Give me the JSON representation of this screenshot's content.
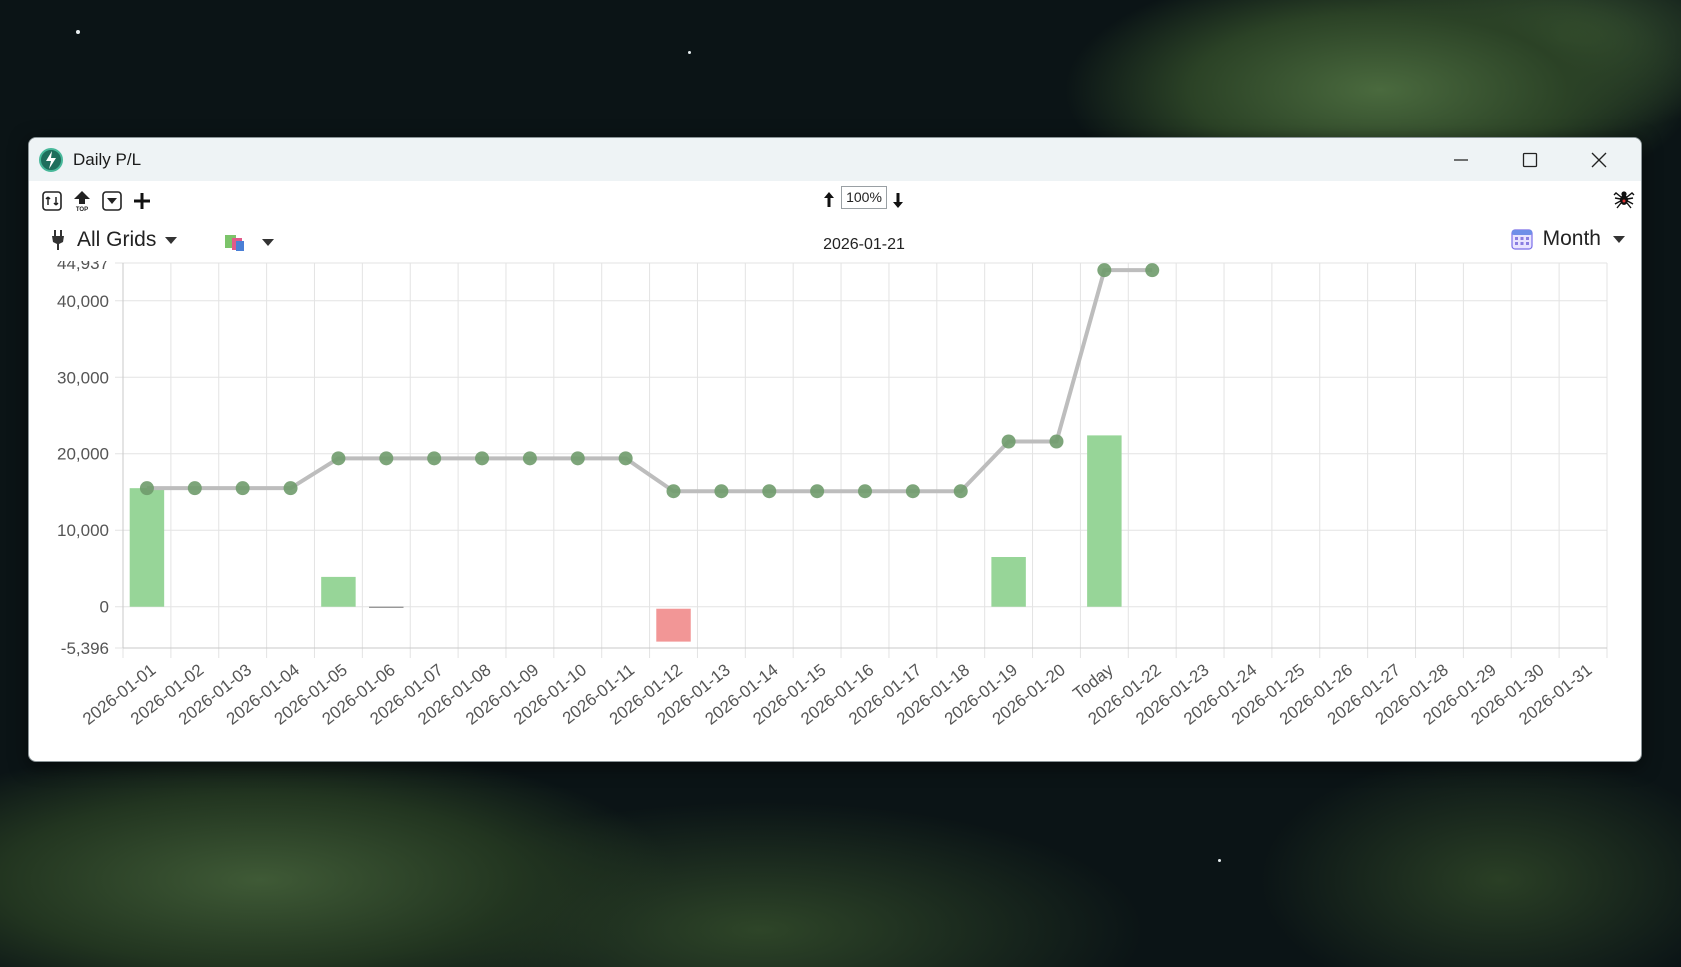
{
  "window": {
    "title": "Daily P/L"
  },
  "toolbar": {
    "zoom_value": "100%",
    "icons": [
      "refresh-icon",
      "top-icon",
      "dropdown-box-icon",
      "plus-icon",
      "arrow-up-icon",
      "arrow-down-icon",
      "spider-icon"
    ]
  },
  "filters": {
    "grids_label": "All Grids",
    "current_date": "2026-01-21",
    "period_label": "Month"
  },
  "colors": {
    "positive_bar": "#97d598",
    "negative_bar": "#f29696",
    "cumulative_line": "#bdbdbd",
    "point": "#6f9b6b"
  },
  "chart_data": {
    "type": "bar",
    "categories": [
      "2026-01-01",
      "2026-01-02",
      "2026-01-03",
      "2026-01-04",
      "2026-01-05",
      "2026-01-06",
      "2026-01-07",
      "2026-01-08",
      "2026-01-09",
      "2026-01-10",
      "2026-01-11",
      "2026-01-12",
      "2026-01-13",
      "2026-01-14",
      "2026-01-15",
      "2026-01-16",
      "2026-01-17",
      "2026-01-18",
      "2026-01-19",
      "2026-01-20",
      "Today",
      "2026-01-22",
      "2026-01-23",
      "2026-01-24",
      "2026-01-25",
      "2026-01-26",
      "2026-01-27",
      "2026-01-28",
      "2026-01-29",
      "2026-01-30",
      "2026-01-31"
    ],
    "y_ticks": [
      44937,
      40000,
      30000,
      20000,
      10000,
      0,
      -5396
    ],
    "y_tick_labels": [
      "44,937",
      "40,000",
      "30,000",
      "20,000",
      "10,000",
      "0",
      "-5,396"
    ],
    "ylim": [
      -5396,
      44937
    ],
    "grid": true,
    "series": [
      {
        "type": "bar",
        "values": [
          15500,
          0,
          0,
          0,
          3900,
          0,
          0,
          0,
          0,
          0,
          0,
          -4300,
          0,
          0,
          0,
          0,
          0,
          0,
          6500,
          0,
          22400,
          null,
          null,
          null,
          null,
          null,
          null,
          null,
          null,
          null,
          null
        ]
      },
      {
        "type": "line",
        "values": [
          15500,
          15500,
          15500,
          15500,
          19400,
          19400,
          19400,
          19400,
          19400,
          19400,
          19400,
          15100,
          15100,
          15100,
          15100,
          15100,
          15100,
          15100,
          21600,
          21600,
          44000,
          44000,
          null,
          null,
          null,
          null,
          null,
          null,
          null,
          null,
          null
        ]
      }
    ]
  }
}
